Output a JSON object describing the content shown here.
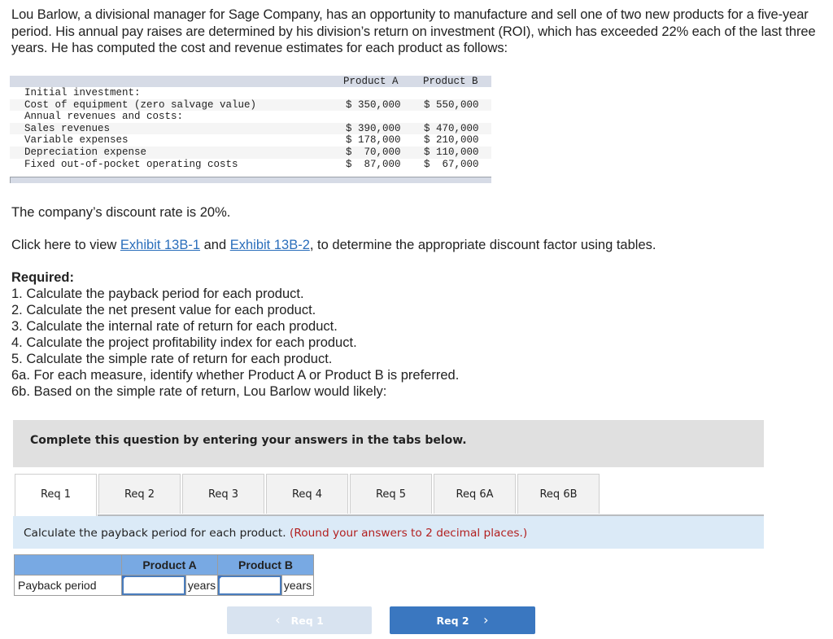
{
  "intro": "Lou Barlow, a divisional manager for Sage Company, has an opportunity to manufacture and sell one of two new products for a five-year period. His annual pay raises are determined by his division’s return on investment (ROI), which has exceeded 22% each of the last three years. He has computed the cost and revenue estimates for each product as follows:",
  "cost_table": {
    "headers": [
      "Product A",
      "Product B"
    ],
    "rows": [
      {
        "label": "Initial investment:",
        "a": "",
        "b": ""
      },
      {
        "label": "Cost of equipment (zero salvage value)",
        "a": "$ 350,000",
        "b": "$ 550,000"
      },
      {
        "label": "Annual revenues and costs:",
        "a": "",
        "b": ""
      },
      {
        "label": "Sales revenues",
        "a": "$ 390,000",
        "b": "$ 470,000"
      },
      {
        "label": "Variable expenses",
        "a": "$ 178,000",
        "b": "$ 210,000"
      },
      {
        "label": "Depreciation expense",
        "a": "$  70,000",
        "b": "$ 110,000"
      },
      {
        "label": "Fixed out-of-pocket operating costs",
        "a": "$  87,000",
        "b": "$  67,000"
      }
    ]
  },
  "discount_text": "The company’s discount rate is 20%.",
  "exhibit_line": {
    "prefix": "Click here to view ",
    "link1": "Exhibit 13B-1",
    "middle": " and ",
    "link2": "Exhibit 13B-2",
    "suffix": ", to determine the appropriate discount factor using tables."
  },
  "required": {
    "title": "Required:",
    "items": [
      "1. Calculate the payback period for each product.",
      "2. Calculate the net present value for each product.",
      "3. Calculate the internal rate of return for each product.",
      "4. Calculate the project profitability index for each product.",
      "5. Calculate the simple rate of return for each product.",
      "6a. For each measure, identify whether Product A or Product B is preferred.",
      "6b. Based on the simple rate of return, Lou Barlow would likely:"
    ]
  },
  "complete_box": "Complete this question by entering your answers in the tabs below.",
  "tabs": [
    {
      "label": "Req 1",
      "active": true
    },
    {
      "label": "Req 2",
      "active": false
    },
    {
      "label": "Req 3",
      "active": false
    },
    {
      "label": "Req 4",
      "active": false
    },
    {
      "label": "Req 5",
      "active": false
    },
    {
      "label": "Req 6A",
      "active": false
    },
    {
      "label": "Req 6B",
      "active": false
    }
  ],
  "instruction": {
    "text": "Calculate the payback period for each product.",
    "note": "(Round your answers to 2 decimal places.)"
  },
  "answer_table": {
    "col_a": "Product A",
    "col_b": "Product B",
    "row_label": "Payback period",
    "value_a": "",
    "value_b": "",
    "unit": "years"
  },
  "nav": {
    "prev_label": "Req 1",
    "next_label": "Req 2",
    "prev_icon": "‹",
    "next_icon": "›"
  },
  "colors": {
    "link": "#2a6ebb",
    "note_red": "#b21f1f",
    "next_button": "#3a77c0",
    "prev_button_disabled": "#d8e3f0",
    "table_header": "#78a9e3",
    "instruction_bg": "#dbeaf7"
  }
}
